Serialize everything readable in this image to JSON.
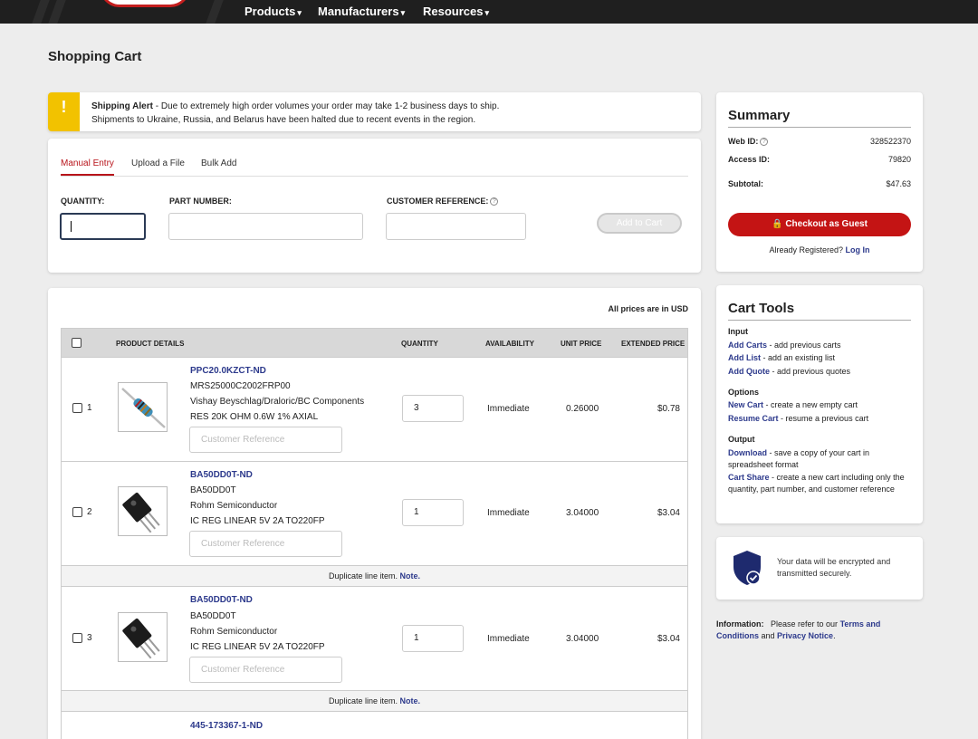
{
  "nav": {
    "items": [
      {
        "label": "Products"
      },
      {
        "label": "Manufacturers"
      },
      {
        "label": "Resources"
      }
    ]
  },
  "page": {
    "title": "Shopping Cart"
  },
  "alert": {
    "icon": "!",
    "title": "Shipping Alert",
    "line1": " - Due to extremely high order volumes your order may take 1-2 business days to ship.",
    "line2": "Shipments to Ukraine, Russia, and Belarus have been halted due to recent events in the region."
  },
  "entry": {
    "tabs": [
      "Manual Entry",
      "Upload a File",
      "Bulk Add"
    ],
    "quantity_label": "QUANTITY:",
    "part_number_label": "PART NUMBER:",
    "customer_reference_label": "CUSTOMER REFERENCE:",
    "quantity_value": "",
    "add_button": "Add to Cart"
  },
  "cart": {
    "currency_note": "All prices are in USD",
    "headers": {
      "product_details": "PRODUCT DETAILS",
      "quantity": "QUANTITY",
      "availability": "AVAILABILITY",
      "unit_price": "UNIT PRICE",
      "extended_price": "EXTENDED PRICE"
    },
    "customer_reference_placeholder": "Customer Reference",
    "rows": [
      {
        "num": "1",
        "part_number": "PPC20.0KZCT-ND",
        "mfr_part": "MRS25000C2002FRP00",
        "manufacturer": "Vishay Beyschlag/Draloric/BC Components",
        "description": "RES 20K OHM 0.6W 1% AXIAL",
        "quantity": "3",
        "availability": "Immediate",
        "unit_price": "0.26000",
        "extended_price": "$0.78"
      },
      {
        "num": "2",
        "part_number": "BA50DD0T-ND",
        "mfr_part": "BA50DD0T",
        "manufacturer": "Rohm Semiconductor",
        "description": "IC REG LINEAR 5V 2A TO220FP",
        "quantity": "1",
        "availability": "Immediate",
        "unit_price": "3.04000",
        "extended_price": "$3.04"
      },
      {
        "num": "3",
        "part_number": "BA50DD0T-ND",
        "mfr_part": "BA50DD0T",
        "manufacturer": "Rohm Semiconductor",
        "description": "IC REG LINEAR 5V 2A TO220FP",
        "quantity": "1",
        "availability": "Immediate",
        "unit_price": "3.04000",
        "extended_price": "$3.04"
      },
      {
        "part_number": "445-173367-1-ND"
      }
    ],
    "duplicate_text": "Duplicate line item. ",
    "duplicate_note": "Note."
  },
  "summary": {
    "title": "Summary",
    "web_id_label": "Web ID:",
    "web_id": "328522370",
    "access_id_label": "Access ID:",
    "access_id": "79820",
    "subtotal_label": "Subtotal:",
    "subtotal": "$47.63",
    "checkout_button": "Checkout as Guest",
    "registered_text": "Already Registered? ",
    "login_link": "Log In"
  },
  "tools": {
    "title": "Cart Tools",
    "input_heading": "Input",
    "add_carts": "Add Carts",
    "add_carts_desc": " - add previous carts",
    "add_list": "Add List",
    "add_list_desc": " - add an existing list",
    "add_quote": "Add Quote",
    "add_quote_desc": " - add previous quotes",
    "options_heading": "Options",
    "new_cart": "New Cart",
    "new_cart_desc": " - create a new empty cart",
    "resume_cart": "Resume Cart",
    "resume_cart_desc": " - resume a previous cart",
    "output_heading": "Output",
    "download": "Download",
    "download_desc": " - save a copy of your cart in spreadsheet format",
    "cart_share": "Cart Share",
    "cart_share_desc": " - create a new cart including only the quantity, part number, and customer reference"
  },
  "secure": {
    "text": "Your data will be encrypted and transmitted securely."
  },
  "info": {
    "label": "Information:",
    "text": "Please refer to our ",
    "terms": "Terms and Conditions",
    "and": " and ",
    "privacy": "Privacy Notice",
    "period": "."
  },
  "colors": {
    "brand_red": "#c41414",
    "link_blue": "#2d3a8c",
    "alert_yellow": "#f2c200"
  }
}
